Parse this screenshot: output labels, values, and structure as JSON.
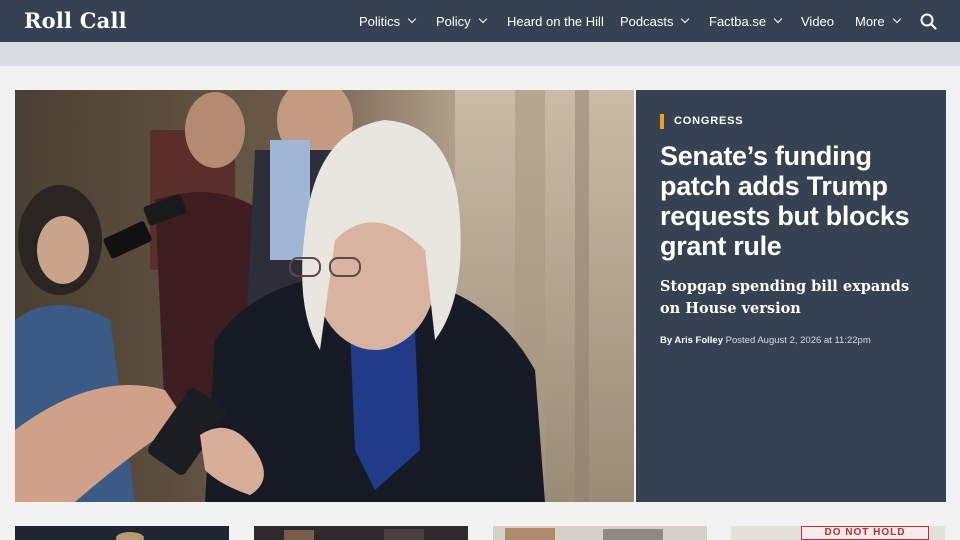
{
  "site": {
    "logo": "Roll Call"
  },
  "nav": {
    "items": [
      {
        "label": "Politics",
        "dropdown": true
      },
      {
        "label": "Policy",
        "dropdown": true
      },
      {
        "label": "Heard on the Hill",
        "dropdown": false
      },
      {
        "label": "Podcasts",
        "dropdown": true
      },
      {
        "label": "Factba.se",
        "dropdown": true
      },
      {
        "label": "Video",
        "dropdown": false
      },
      {
        "label": "More",
        "dropdown": true
      }
    ],
    "search_icon": "search-icon"
  },
  "hero": {
    "kicker": "CONGRESS",
    "headline": "Senate’s funding patch adds Trump requests but blocks grant rule",
    "dek": "Stopgap spending bill expands on House version",
    "byline": {
      "by": "By Aris Folley",
      "posted": "Posted August 2, 2026 at 11:22pm"
    }
  },
  "thumbs": {
    "stamp_text": "DO NOT HOLD"
  },
  "colors": {
    "nav_bg": "#364152",
    "accent": "#e9a21e",
    "panel_bg": "#364152",
    "page_bg": "#f2f2f2"
  }
}
